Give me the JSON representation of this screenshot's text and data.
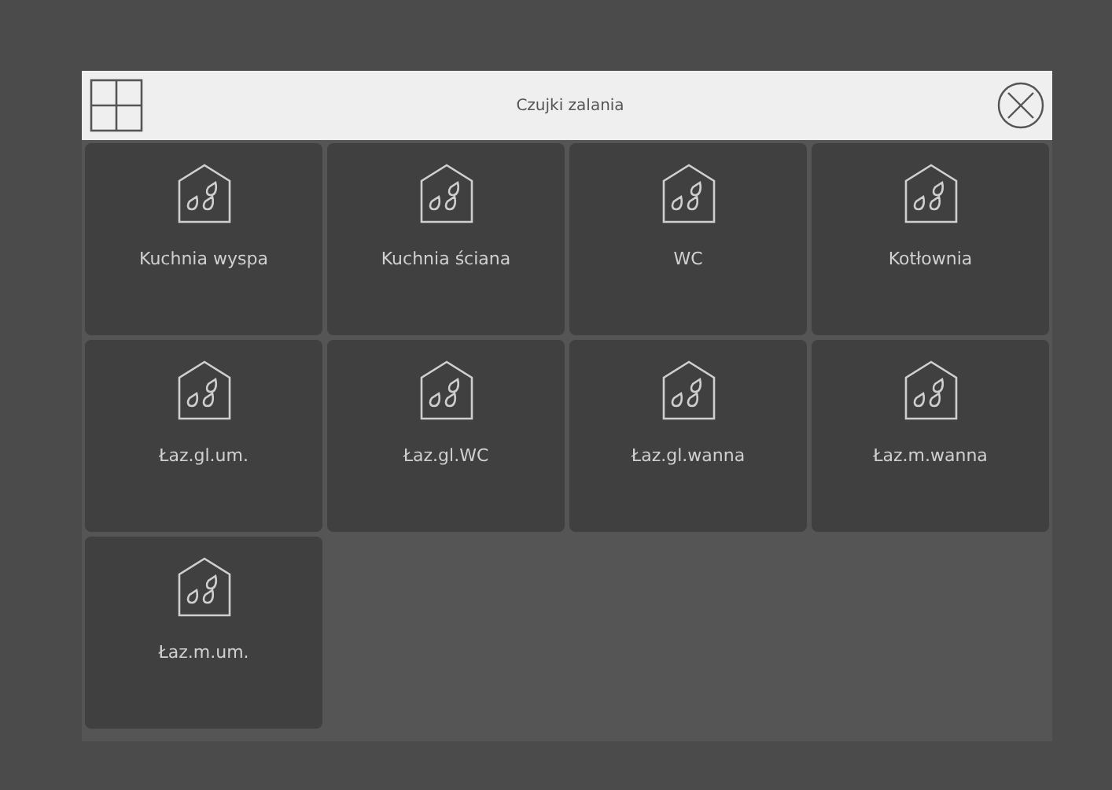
{
  "header": {
    "title": "Czujki zalania"
  },
  "sensors": [
    {
      "label": "Kuchnia wyspa"
    },
    {
      "label": "Kuchnia ściana"
    },
    {
      "label": "WC"
    },
    {
      "label": "Kotłownia"
    },
    {
      "label": "Łaz.gl.um."
    },
    {
      "label": "Łaz.gl.WC"
    },
    {
      "label": "Łaz.gl.wanna"
    },
    {
      "label": "Łaz.m.wanna"
    },
    {
      "label": "Łaz.m.um."
    }
  ]
}
